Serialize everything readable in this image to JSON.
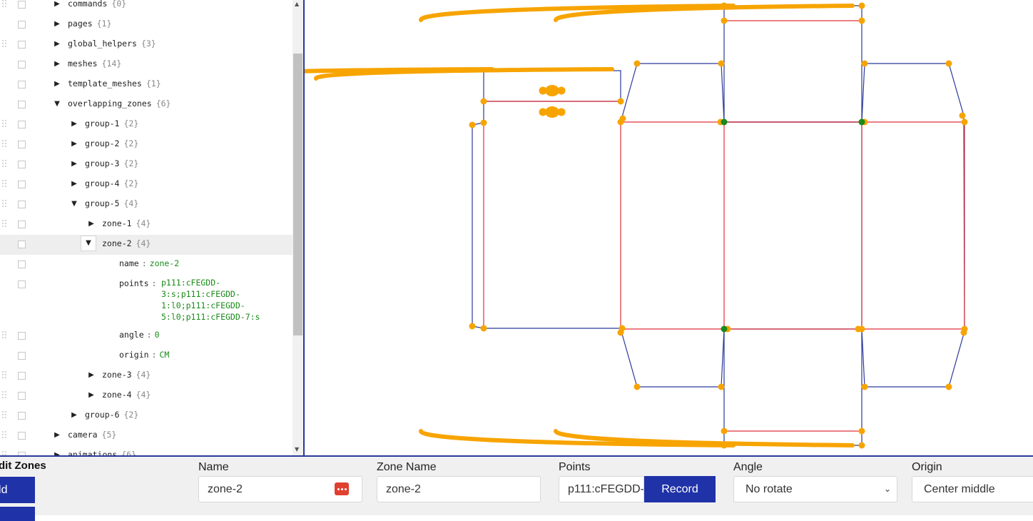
{
  "tree": {
    "rows": [
      {
        "key": "commands",
        "count": "{0}",
        "state": "collapsed"
      },
      {
        "key": "pages",
        "count": "{1}",
        "state": "collapsed"
      },
      {
        "key": "global_helpers",
        "count": "{3}",
        "state": "collapsed"
      },
      {
        "key": "meshes",
        "count": "{14}",
        "state": "collapsed"
      },
      {
        "key": "template_meshes",
        "count": "{1}",
        "state": "collapsed"
      },
      {
        "key": "overlapping_zones",
        "count": "{6}",
        "state": "expanded"
      },
      {
        "key": "group-1",
        "count": "{2}",
        "state": "collapsed"
      },
      {
        "key": "group-2",
        "count": "{2}",
        "state": "collapsed"
      },
      {
        "key": "group-3",
        "count": "{2}",
        "state": "collapsed"
      },
      {
        "key": "group-4",
        "count": "{2}",
        "state": "collapsed"
      },
      {
        "key": "group-5",
        "count": "{4}",
        "state": "expanded"
      },
      {
        "key": "zone-1",
        "count": "{4}",
        "state": "collapsed"
      },
      {
        "key": "zone-2",
        "count": "{4}",
        "state": "expanded",
        "selected": true
      },
      {
        "key": "name",
        "value": "zone-2"
      },
      {
        "key": "points",
        "value": "p111:cFEGDD-\n3:s;p111:cFEGDD-\n1:l0;p111:cFEGDD-\n5:l0;p111:cFEGDD-7:s"
      },
      {
        "key": "angle",
        "value": "0"
      },
      {
        "key": "origin",
        "value": "CM"
      },
      {
        "key": "zone-3",
        "count": "{4}",
        "state": "collapsed"
      },
      {
        "key": "zone-4",
        "count": "{4}",
        "state": "collapsed"
      },
      {
        "key": "group-6",
        "count": "{2}",
        "state": "collapsed"
      },
      {
        "key": "camera",
        "count": "{5}",
        "state": "collapsed"
      },
      {
        "key": "animations",
        "count": "{6}",
        "state": "collapsed"
      }
    ]
  },
  "icons": {
    "collapsed": "caret-right-icon",
    "expanded": "caret-down-icon",
    "drag": "drag-handle-icon",
    "scroll_up": "scroll-up-arrow-icon",
    "scroll_down": "scroll-down-arrow-icon",
    "password": "password-manager-icon",
    "select": "chevron-down-icon"
  },
  "glyphs": {
    "collapsed": "▶",
    "expanded": "▼",
    "up": "▲",
    "down": "▼",
    "select": "⌄"
  },
  "form": {
    "title": "Edit Zones",
    "add_label": "Add",
    "name": {
      "label": "Name",
      "value": "zone-2"
    },
    "zone_name": {
      "label": "Zone Name",
      "value": "zone-2"
    },
    "points": {
      "label": "Points",
      "value": "p111:cFEGDD-3:s;p111:cFEGDD-1:l0;p111:cFEGDD-5:l0;p111:cFEGDD-7:s"
    },
    "record_label": "Record",
    "angle": {
      "label": "Angle",
      "value": "No rotate"
    },
    "origin": {
      "label": "Origin",
      "value": "Center middle"
    }
  },
  "colors": {
    "accent": "#2032a8",
    "cut_line": "#2b3a9a",
    "fold_line": "#e0303a",
    "handle": "#f7a400",
    "anchor_point": "#1a8a1a",
    "json_value": "#1a8a1a"
  }
}
